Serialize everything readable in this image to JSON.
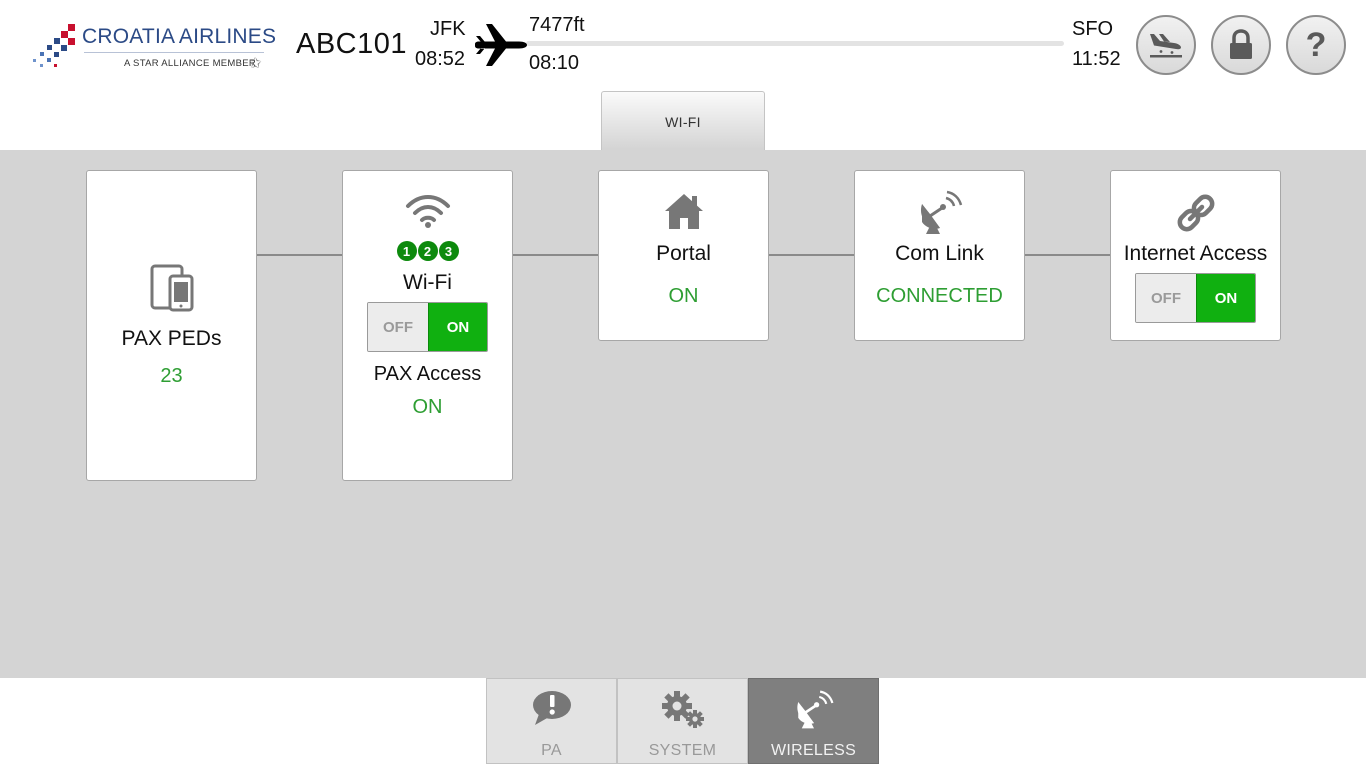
{
  "header": {
    "airline_name": "CROATIA AIRLINES",
    "airline_tagline": "A STAR ALLIANCE MEMBER",
    "flight_number": "ABC101",
    "origin": {
      "code": "JFK",
      "time": "08:52"
    },
    "destination": {
      "code": "SFO",
      "time": "11:52"
    },
    "altitude": "7477ft",
    "elapsed_time": "08:10",
    "progress_fraction": 0.0,
    "buttons": [
      {
        "name": "landing-button",
        "icon": "airplane-landing-icon"
      },
      {
        "name": "lock-button",
        "icon": "lock-icon"
      },
      {
        "name": "help-button",
        "icon": "help-icon",
        "glyph": "?"
      }
    ]
  },
  "tabs": [
    {
      "label": "WI-FI",
      "active": true
    }
  ],
  "cards": {
    "pax_peds": {
      "icon": "devices-icon",
      "title": "PAX PEDs",
      "value": "23"
    },
    "wifi": {
      "icon": "wifi-icon",
      "ssids": [
        "1",
        "2",
        "3"
      ],
      "title": "Wi-Fi",
      "toggle": {
        "off_label": "OFF",
        "on_label": "ON",
        "state": "on"
      },
      "pax_access_label": "PAX Access",
      "pax_access_value": "ON"
    },
    "portal": {
      "icon": "home-icon",
      "title": "Portal",
      "value": "ON"
    },
    "com_link": {
      "icon": "satellite-dish-icon",
      "title": "Com Link",
      "value": "CONNECTED"
    },
    "internet_access": {
      "icon": "link-icon",
      "title": "Internet Access",
      "toggle": {
        "off_label": "OFF",
        "on_label": "ON",
        "state": "on"
      }
    }
  },
  "bottom_nav": [
    {
      "label": "PA",
      "icon": "pa-alert-icon",
      "active": false
    },
    {
      "label": "SYSTEM",
      "icon": "gears-icon",
      "active": false
    },
    {
      "label": "WIRELESS",
      "icon": "satellite-dish-icon",
      "active": true
    }
  ],
  "colors": {
    "status_green": "#2e9e33",
    "toggle_on": "#10b010",
    "ssid_badge": "#0d8a0d",
    "panel_gray": "#d4d4d4",
    "active_nav": "#7f7f7f",
    "brand_blue": "#2b4a86",
    "brand_red": "#c8102e"
  }
}
